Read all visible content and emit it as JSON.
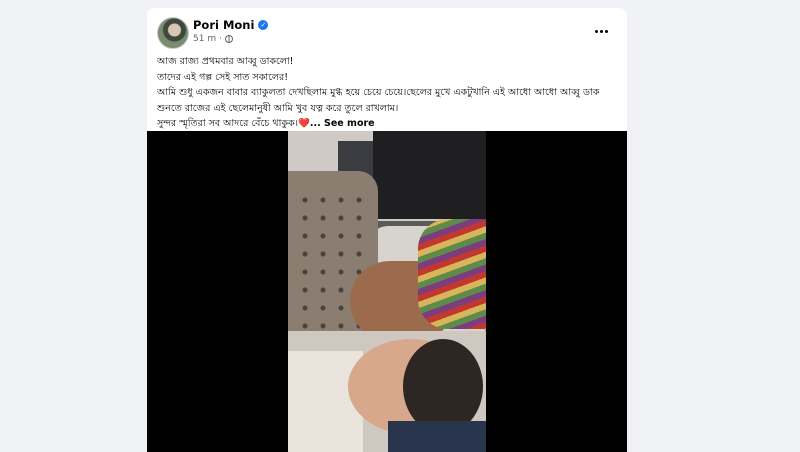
{
  "post": {
    "author": "Pori Moni",
    "time": "51 m",
    "caption_lines": [
      "আজ রাজ্য প্রথমবার আব্বু ডাকলো!",
      "তাদের এই গল্প সেই  সাত সকালের!",
      "আমি শুধু একজন বাবার ব্যাকুলতা দেখছিলাম মুগ্ধ হয়ে চেয়ে চেয়ে।ছেলের মুখে একটুখানি এই আধো আধো আব্বু ডাক",
      "শুনতে রাজের এই ছেলেমানুষী আমি খুব যত্ন করে তুলে রাখলাম।"
    ],
    "last_line": "সুন্দর স্মৃতিরা সব আদরে বেঁচে থাকুক।",
    "heart": "❤️",
    "see_more": "... See more"
  },
  "icons": {
    "verified": "verified-badge-icon",
    "audience": "globe-icon",
    "more": "more-options-icon"
  },
  "colors": {
    "page_bg": "#f0f2f5",
    "card_bg": "#ffffff",
    "verified_blue": "#1877f2",
    "heart_red": "#e41e3f"
  }
}
